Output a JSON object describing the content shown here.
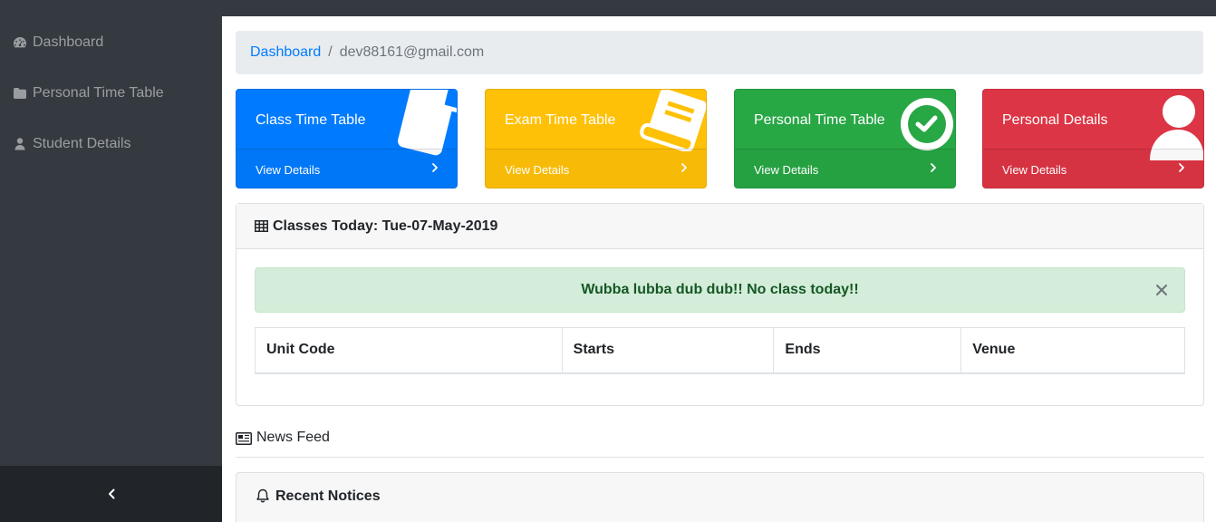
{
  "sidebar": {
    "items": [
      {
        "label": "Dashboard",
        "icon": "tachometer-icon"
      },
      {
        "label": "Personal Time Table",
        "icon": "folder-icon"
      },
      {
        "label": "Student Details",
        "icon": "user-icon"
      }
    ],
    "toggle_icon": "chevron-left-icon"
  },
  "breadcrumb": {
    "home": "Dashboard",
    "separator": "/",
    "current": "dev88161@gmail.com"
  },
  "cards": [
    {
      "title": "Class Time Table",
      "footer": "View Details",
      "color": "#007bff",
      "icon": "clipboard-icon"
    },
    {
      "title": "Exam Time Table",
      "footer": "View Details",
      "color": "#ffc107",
      "icon": "book-icon"
    },
    {
      "title": "Personal Time Table",
      "footer": "View Details",
      "color": "#28a745",
      "icon": "clock-check-icon"
    },
    {
      "title": "Personal Details",
      "footer": "View Details",
      "color": "#dc3545",
      "icon": "user-icon"
    }
  ],
  "classes": {
    "title": "Classes Today: Tue-07-May-2019",
    "alert": "Wubba lubba dub dub!! No class today!!",
    "columns": [
      "Unit Code",
      "Starts",
      "Ends",
      "Venue"
    ]
  },
  "news_feed": {
    "label": "News Feed"
  },
  "notices": {
    "title": "Recent Notices"
  },
  "colors": {
    "sidebar_bg": "#343a40",
    "link": "#007bff",
    "alert_bg": "#d4edda",
    "alert_text": "#155724"
  }
}
